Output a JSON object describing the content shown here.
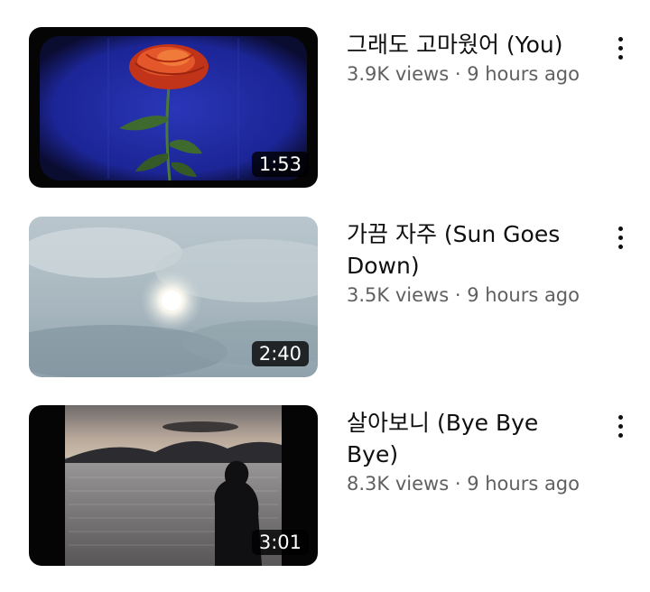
{
  "videos": [
    {
      "title": "그래도 고마웠어 (You)",
      "views": "3.9K views",
      "age": "9 hours ago",
      "duration": "1:53"
    },
    {
      "title": "가끔 자주 (Sun Goes Down)",
      "views": "3.5K views",
      "age": "9 hours ago",
      "duration": "2:40"
    },
    {
      "title": "살아보니 (Bye Bye Bye)",
      "views": "8.3K views",
      "age": "9 hours ago",
      "duration": "3:01"
    }
  ],
  "stats_separator": " · ",
  "icons": {
    "menu": "more-vertical-icon"
  }
}
